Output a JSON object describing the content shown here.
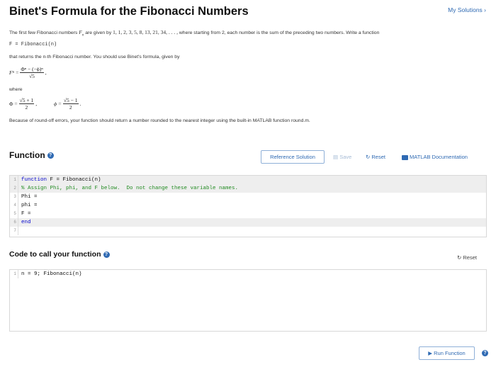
{
  "header": {
    "title": "Binet's Formula for the Fibonacci Numbers",
    "my_solutions": "My Solutions ›"
  },
  "description": {
    "p1_a": "The first few Fibonacci numbers ",
    "p1_var": "F",
    "p1_sub": "n",
    "p1_b": " are given by ",
    "p1_seq": "1, 1, 2, 3, 5, 8, 13, 21, 34, . . . ,",
    "p1_c": " where starting from 2, each number is the sum of the preceding two numbers. Write a function",
    "signature": "F = Fibonacci(n)",
    "p2": "that returns the n-th Fibonacci number.  You should use Binet's formula, given by",
    "binet_lhs": "F",
    "binet_sub": "n",
    "binet_eq": "=",
    "binet_num": "Φⁿ − (−ϕ)ⁿ",
    "binet_den": "√5",
    "binet_end": ",",
    "where": "where",
    "phi_upper": "Φ =",
    "phi_upper_num": "√5 + 1",
    "phi_upper_den": "2",
    "phi_lower": "ϕ =",
    "phi_lower_num": "√5 − 1",
    "phi_lower_den": "2",
    "comma": ",",
    "period": ".",
    "p3": "Because of round-off errors, your function should return a number rounded to the nearest integer using the built-in MATLAB function round.m."
  },
  "function_section": {
    "title": "Function",
    "help": "?",
    "reference_solution": "Reference Solution",
    "save": "Save",
    "reset": "Reset",
    "matlab_doc": "MATLAB Documentation",
    "lines": [
      {
        "n": "1",
        "kw": "function",
        "text": " F = Fibonacci(n)"
      },
      {
        "n": "2",
        "comment": "% Assign Phi, phi, and F below.  Do not change these variable names."
      },
      {
        "n": "3",
        "text": "Phi ="
      },
      {
        "n": "4",
        "text": "phi ="
      },
      {
        "n": "5",
        "text": "F ="
      },
      {
        "n": "6",
        "kw": "end"
      },
      {
        "n": "7",
        "text": ""
      }
    ]
  },
  "call_section": {
    "title": "Code to call your function",
    "help": "?",
    "reset": "Reset",
    "lines": [
      {
        "n": "1",
        "text": "n = 9; Fibonacci(n)"
      }
    ]
  },
  "footer": {
    "run_function": "Run Function",
    "help": "?"
  },
  "colors": {
    "accent": "#2f6ab3",
    "locked_line": "#eeeeee",
    "comment": "#228b22",
    "keyword": "#0000cc"
  }
}
